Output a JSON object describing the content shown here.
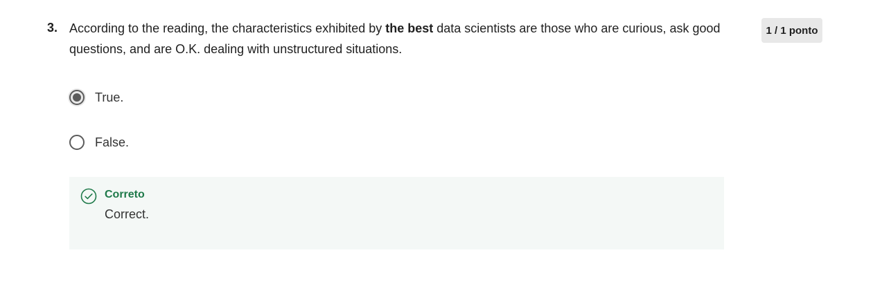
{
  "question": {
    "number": "3.",
    "text_before": "According to the reading, the characteristics exhibited by ",
    "text_bold": "the best",
    "text_after": " data scientists are those who are curious, ask good questions, and are O.K. dealing with unstructured situations.",
    "points": "1 / 1 ponto"
  },
  "options": [
    {
      "label": "True.",
      "selected": true
    },
    {
      "label": "False.",
      "selected": false
    }
  ],
  "feedback": {
    "status": "Correto",
    "message": "Correct.",
    "icon": "check-circle-icon",
    "status_color": "#1f7a4a"
  }
}
